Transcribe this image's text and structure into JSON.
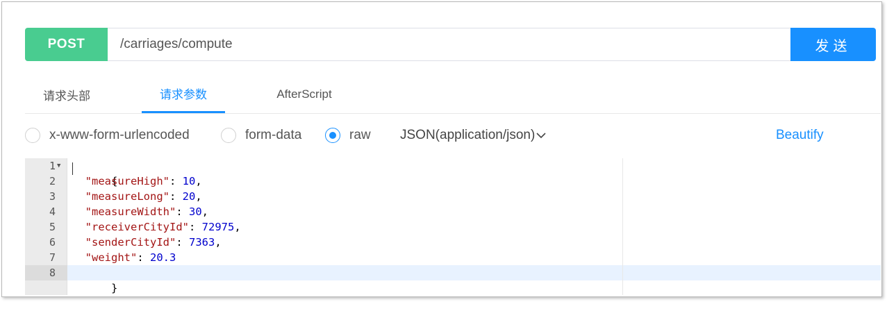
{
  "request": {
    "method": "POST",
    "url": "/carriages/compute",
    "send_label": "发送"
  },
  "tabs": [
    {
      "label": "请求头部",
      "active": false
    },
    {
      "label": "请求参数",
      "active": true
    },
    {
      "label": "AfterScript",
      "active": false
    }
  ],
  "body_types": [
    {
      "label": "x-www-form-urlencoded",
      "checked": false
    },
    {
      "label": "form-data",
      "checked": false
    },
    {
      "label": "raw",
      "checked": true
    }
  ],
  "content_type": "JSON(application/json)",
  "beautify_label": "Beautify",
  "editor": {
    "line_numbers": [
      "1",
      "2",
      "3",
      "4",
      "5",
      "6",
      "7",
      "8"
    ],
    "open_brace": "{",
    "close_brace": "}",
    "fields": [
      {
        "key": "\"measureHigh\"",
        "value": "10",
        "comma": ","
      },
      {
        "key": "\"measureLong\"",
        "value": "20",
        "comma": ","
      },
      {
        "key": "\"measureWidth\"",
        "value": "30",
        "comma": ","
      },
      {
        "key": "\"receiverCityId\"",
        "value": "72975",
        "comma": ","
      },
      {
        "key": "\"senderCityId\"",
        "value": "7363",
        "comma": ","
      },
      {
        "key": "\"weight\"",
        "value": "20.3",
        "comma": ""
      }
    ]
  },
  "colors": {
    "method_bg": "#49cc90",
    "send_bg": "#1890ff",
    "accent": "#1890ff",
    "json_key": "#a31515",
    "json_number": "#0000cd"
  }
}
